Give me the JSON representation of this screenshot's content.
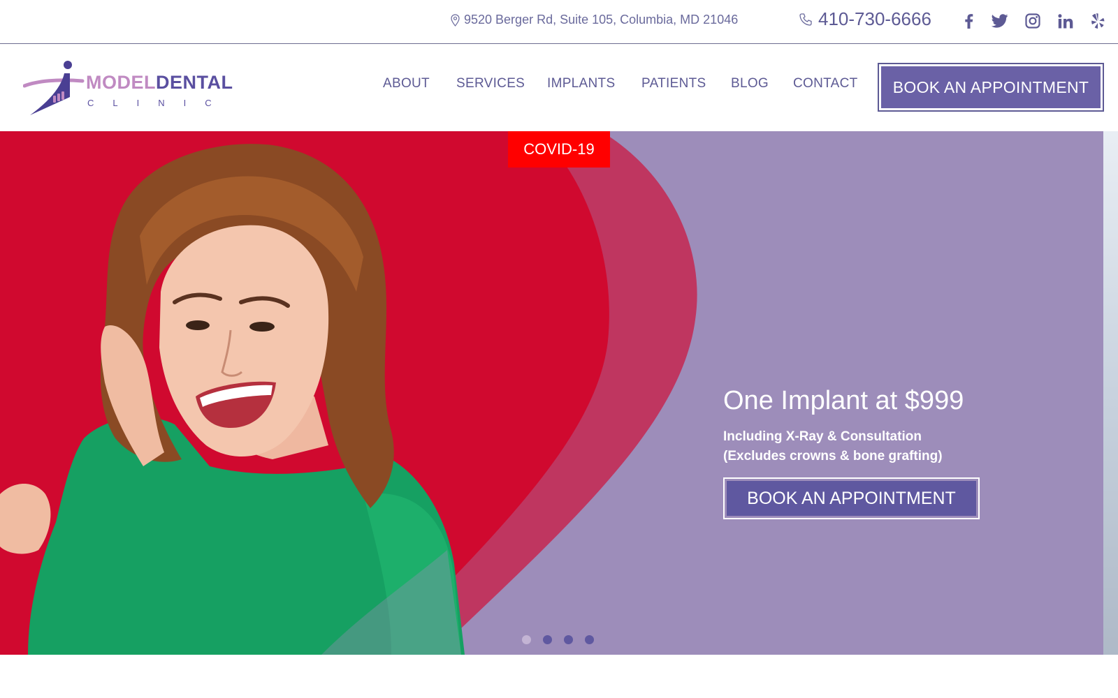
{
  "topbar": {
    "address": "9520 Berger Rd, Suite 105, Columbia, MD 21046",
    "phone": "410-730-6666",
    "social": [
      "facebook-icon",
      "twitter-icon",
      "instagram-icon",
      "linkedin-icon",
      "yelp-icon"
    ]
  },
  "logo": {
    "word_a": "MODEL",
    "word_b": "DENTAL",
    "sub": "CLINIC"
  },
  "nav": {
    "items": [
      "ABOUT",
      "SERVICES",
      "IMPLANTS",
      "PATIENTS",
      "BLOG",
      "CONTACT"
    ],
    "book_label": "BOOK AN APPOINTMENT"
  },
  "hero": {
    "badge": "COVID-19",
    "title": "One Implant at $999",
    "sub_line1": "Including X-Ray & Consultation",
    "sub_line2": "(Excludes crowns & bone grafting)",
    "cta_label": "BOOK AN APPOINTMENT",
    "slides": 4,
    "active_slide": 1
  },
  "colors": {
    "brand_purple": "#5d5a94",
    "button_purple": "#6a61a6",
    "hero_lavender": "#9d8dba",
    "hero_red": "#d0092f",
    "badge_red": "#ff0000",
    "sweater_green": "#16a062",
    "logo_pink": "#c08ac2"
  }
}
